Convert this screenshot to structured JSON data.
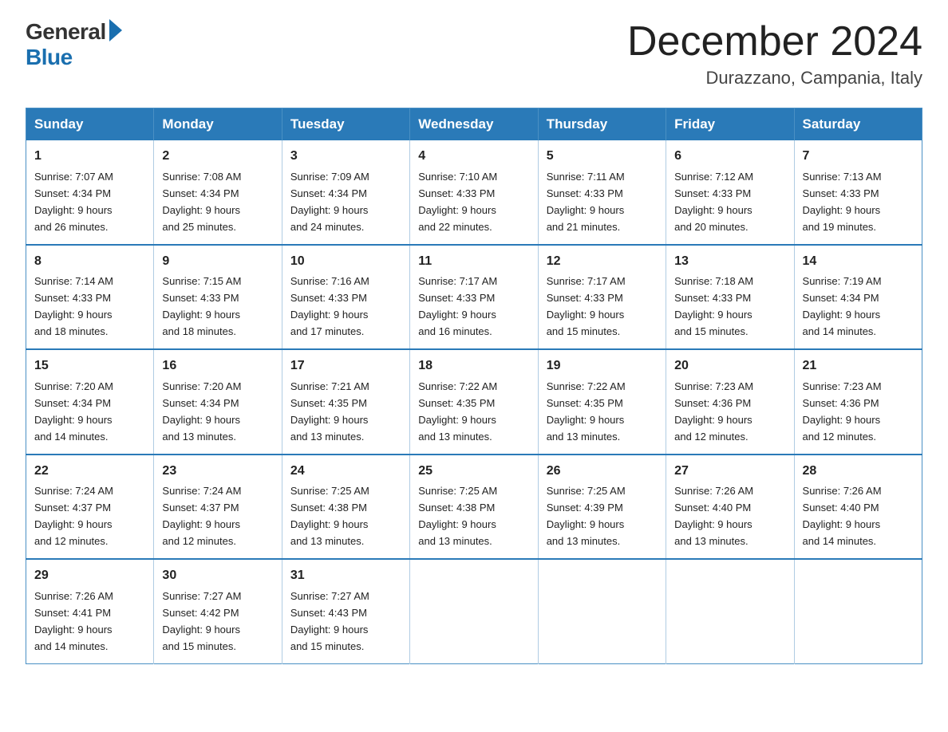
{
  "logo": {
    "general": "General",
    "blue": "Blue"
  },
  "header": {
    "month": "December 2024",
    "location": "Durazzano, Campania, Italy"
  },
  "weekdays": [
    "Sunday",
    "Monday",
    "Tuesday",
    "Wednesday",
    "Thursday",
    "Friday",
    "Saturday"
  ],
  "weeks": [
    [
      {
        "day": "1",
        "sunrise": "7:07 AM",
        "sunset": "4:34 PM",
        "daylight": "9 hours and 26 minutes."
      },
      {
        "day": "2",
        "sunrise": "7:08 AM",
        "sunset": "4:34 PM",
        "daylight": "9 hours and 25 minutes."
      },
      {
        "day": "3",
        "sunrise": "7:09 AM",
        "sunset": "4:34 PM",
        "daylight": "9 hours and 24 minutes."
      },
      {
        "day": "4",
        "sunrise": "7:10 AM",
        "sunset": "4:33 PM",
        "daylight": "9 hours and 22 minutes."
      },
      {
        "day": "5",
        "sunrise": "7:11 AM",
        "sunset": "4:33 PM",
        "daylight": "9 hours and 21 minutes."
      },
      {
        "day": "6",
        "sunrise": "7:12 AM",
        "sunset": "4:33 PM",
        "daylight": "9 hours and 20 minutes."
      },
      {
        "day": "7",
        "sunrise": "7:13 AM",
        "sunset": "4:33 PM",
        "daylight": "9 hours and 19 minutes."
      }
    ],
    [
      {
        "day": "8",
        "sunrise": "7:14 AM",
        "sunset": "4:33 PM",
        "daylight": "9 hours and 18 minutes."
      },
      {
        "day": "9",
        "sunrise": "7:15 AM",
        "sunset": "4:33 PM",
        "daylight": "9 hours and 18 minutes."
      },
      {
        "day": "10",
        "sunrise": "7:16 AM",
        "sunset": "4:33 PM",
        "daylight": "9 hours and 17 minutes."
      },
      {
        "day": "11",
        "sunrise": "7:17 AM",
        "sunset": "4:33 PM",
        "daylight": "9 hours and 16 minutes."
      },
      {
        "day": "12",
        "sunrise": "7:17 AM",
        "sunset": "4:33 PM",
        "daylight": "9 hours and 15 minutes."
      },
      {
        "day": "13",
        "sunrise": "7:18 AM",
        "sunset": "4:33 PM",
        "daylight": "9 hours and 15 minutes."
      },
      {
        "day": "14",
        "sunrise": "7:19 AM",
        "sunset": "4:34 PM",
        "daylight": "9 hours and 14 minutes."
      }
    ],
    [
      {
        "day": "15",
        "sunrise": "7:20 AM",
        "sunset": "4:34 PM",
        "daylight": "9 hours and 14 minutes."
      },
      {
        "day": "16",
        "sunrise": "7:20 AM",
        "sunset": "4:34 PM",
        "daylight": "9 hours and 13 minutes."
      },
      {
        "day": "17",
        "sunrise": "7:21 AM",
        "sunset": "4:35 PM",
        "daylight": "9 hours and 13 minutes."
      },
      {
        "day": "18",
        "sunrise": "7:22 AM",
        "sunset": "4:35 PM",
        "daylight": "9 hours and 13 minutes."
      },
      {
        "day": "19",
        "sunrise": "7:22 AM",
        "sunset": "4:35 PM",
        "daylight": "9 hours and 13 minutes."
      },
      {
        "day": "20",
        "sunrise": "7:23 AM",
        "sunset": "4:36 PM",
        "daylight": "9 hours and 12 minutes."
      },
      {
        "day": "21",
        "sunrise": "7:23 AM",
        "sunset": "4:36 PM",
        "daylight": "9 hours and 12 minutes."
      }
    ],
    [
      {
        "day": "22",
        "sunrise": "7:24 AM",
        "sunset": "4:37 PM",
        "daylight": "9 hours and 12 minutes."
      },
      {
        "day": "23",
        "sunrise": "7:24 AM",
        "sunset": "4:37 PM",
        "daylight": "9 hours and 12 minutes."
      },
      {
        "day": "24",
        "sunrise": "7:25 AM",
        "sunset": "4:38 PM",
        "daylight": "9 hours and 13 minutes."
      },
      {
        "day": "25",
        "sunrise": "7:25 AM",
        "sunset": "4:38 PM",
        "daylight": "9 hours and 13 minutes."
      },
      {
        "day": "26",
        "sunrise": "7:25 AM",
        "sunset": "4:39 PM",
        "daylight": "9 hours and 13 minutes."
      },
      {
        "day": "27",
        "sunrise": "7:26 AM",
        "sunset": "4:40 PM",
        "daylight": "9 hours and 13 minutes."
      },
      {
        "day": "28",
        "sunrise": "7:26 AM",
        "sunset": "4:40 PM",
        "daylight": "9 hours and 14 minutes."
      }
    ],
    [
      {
        "day": "29",
        "sunrise": "7:26 AM",
        "sunset": "4:41 PM",
        "daylight": "9 hours and 14 minutes."
      },
      {
        "day": "30",
        "sunrise": "7:27 AM",
        "sunset": "4:42 PM",
        "daylight": "9 hours and 15 minutes."
      },
      {
        "day": "31",
        "sunrise": "7:27 AM",
        "sunset": "4:43 PM",
        "daylight": "9 hours and 15 minutes."
      },
      null,
      null,
      null,
      null
    ]
  ],
  "labels": {
    "sunrise": "Sunrise:",
    "sunset": "Sunset:",
    "daylight": "Daylight:"
  }
}
